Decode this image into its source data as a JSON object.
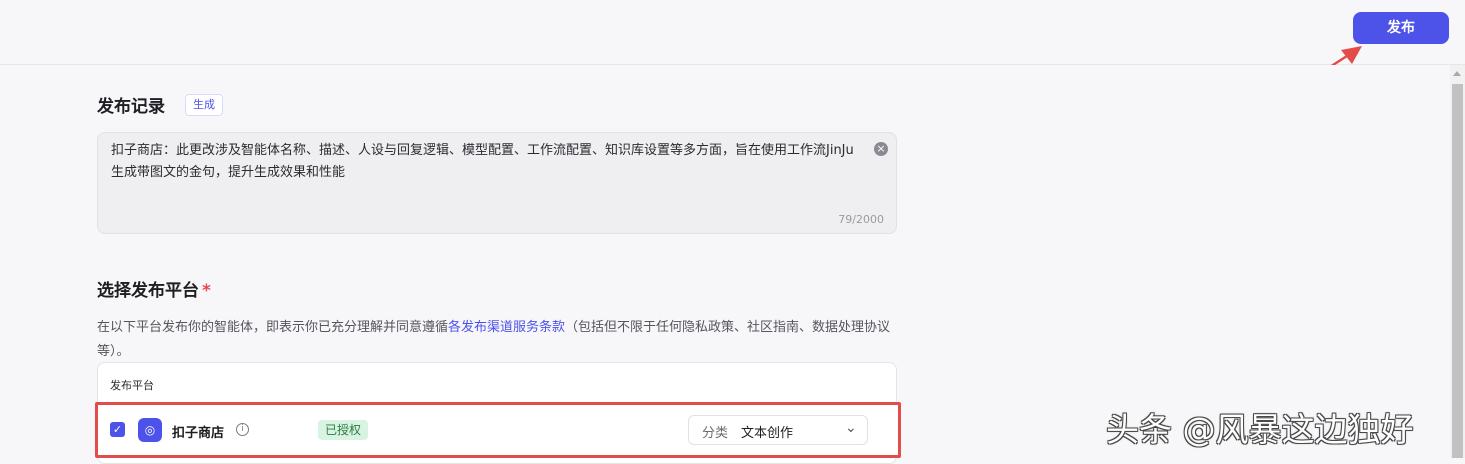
{
  "header": {
    "publish_label": "发布"
  },
  "record": {
    "title": "发布记录",
    "tag": "生成",
    "text": "扣子商店：此更改涉及智能体名称、描述、人设与回复逻辑、模型配置、工作流配置、知识库设置等多方面，旨在使用工作流JinJu生成带图文的金句，提升生成效果和性能",
    "counter": "79/2000"
  },
  "platform_section": {
    "title": "选择发布平台",
    "required_mark": "*",
    "desc_before": "在以下平台发布你的智能体，即表示你已充分理解并同意遵循",
    "desc_link": "各发布渠道服务条款",
    "desc_after": "（包括但不限于任何隐私政策、社区指南、数据处理协议等）。",
    "table_header": "发布平台",
    "row": {
      "name": "扣子商店",
      "auth_status": "已授权",
      "category_label": "分类",
      "category_value": "文本创作",
      "checked": true
    }
  },
  "watermark": "头条 @风暴这边独好",
  "colors": {
    "accent": "#4d53e8",
    "annotation_red": "#e44b4b",
    "auth_green_bg": "#d8f3e1"
  },
  "icons": [
    "close-circle-icon",
    "info-icon",
    "chevron-down-icon",
    "check-icon",
    "store-logo-icon",
    "annotation-arrow"
  ]
}
